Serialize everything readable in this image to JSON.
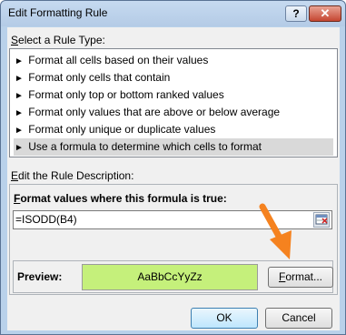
{
  "window": {
    "title": "Edit Formatting Rule",
    "help_label": "?",
    "close_label": "✕"
  },
  "rule_type": {
    "label_prefix": "",
    "label_underlined": "S",
    "label_rest": "elect a Rule Type:",
    "items": [
      {
        "label": "Format all cells based on their values",
        "selected": false
      },
      {
        "label": "Format only cells that contain",
        "selected": false
      },
      {
        "label": "Format only top or bottom ranked values",
        "selected": false
      },
      {
        "label": "Format only values that are above or below average",
        "selected": false
      },
      {
        "label": "Format only unique or duplicate values",
        "selected": false
      },
      {
        "label": "Use a formula to determine which cells to format",
        "selected": true
      }
    ]
  },
  "description": {
    "label_prefix": "",
    "label_underlined": "E",
    "label_rest": "dit the Rule Description:",
    "formula_title_underlined": "F",
    "formula_title_rest": "ormat values where this formula is true:",
    "formula_value": "=ISODD(B4)",
    "preview_label": "Preview:",
    "preview_sample": "AaBbCcYyZz",
    "format_button_underlined": "F",
    "format_button_rest": "ormat..."
  },
  "buttons": {
    "ok": "OK",
    "cancel": "Cancel"
  },
  "colors": {
    "preview_fill": "#c5f07b",
    "annotation_arrow": "#f5821f",
    "window_frame": "#b9d1ea"
  }
}
